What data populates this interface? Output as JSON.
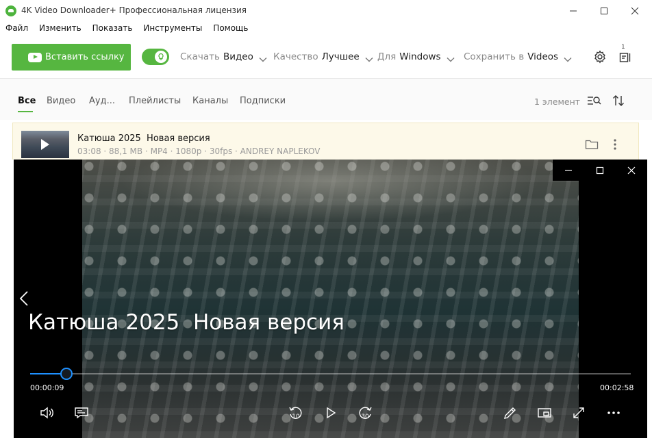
{
  "window": {
    "title": "4K Video Downloader+ Профессиональная лицензия"
  },
  "menu": [
    "Файл",
    "Изменить",
    "Показать",
    "Инструменты",
    "Помощь"
  ],
  "toolbar": {
    "paste_label": "Вставить ссылку",
    "smart_mode_on": true,
    "download_label": "Скачать",
    "download_value": "Видео",
    "quality_label": "Качество",
    "quality_value": "Лучшее",
    "for_label": "Для",
    "for_value": "Windows",
    "save_label": "Сохранить в",
    "save_value": "Videos",
    "badge": "1",
    "accent_color": "#56b640"
  },
  "tabs": {
    "items": [
      "Все",
      "Видео",
      "Ауд...",
      "Плейлисты",
      "Каналы",
      "Подписки"
    ],
    "active": "Все",
    "count": "1 элемент"
  },
  "item": {
    "title": "Катюша 2025  Новая версия",
    "meta": "03:08 · 88,1 MB · MP4 · 1080p · 30fps · ANDREY NAPLEKOV"
  },
  "player": {
    "title": "Катюша 2025  Новая версия",
    "current_time": "00:00:09",
    "remaining_time": "00:02:58",
    "progress": 0.06,
    "skip_back": "10",
    "skip_forward": "30",
    "accent_color": "#1e90ff"
  }
}
